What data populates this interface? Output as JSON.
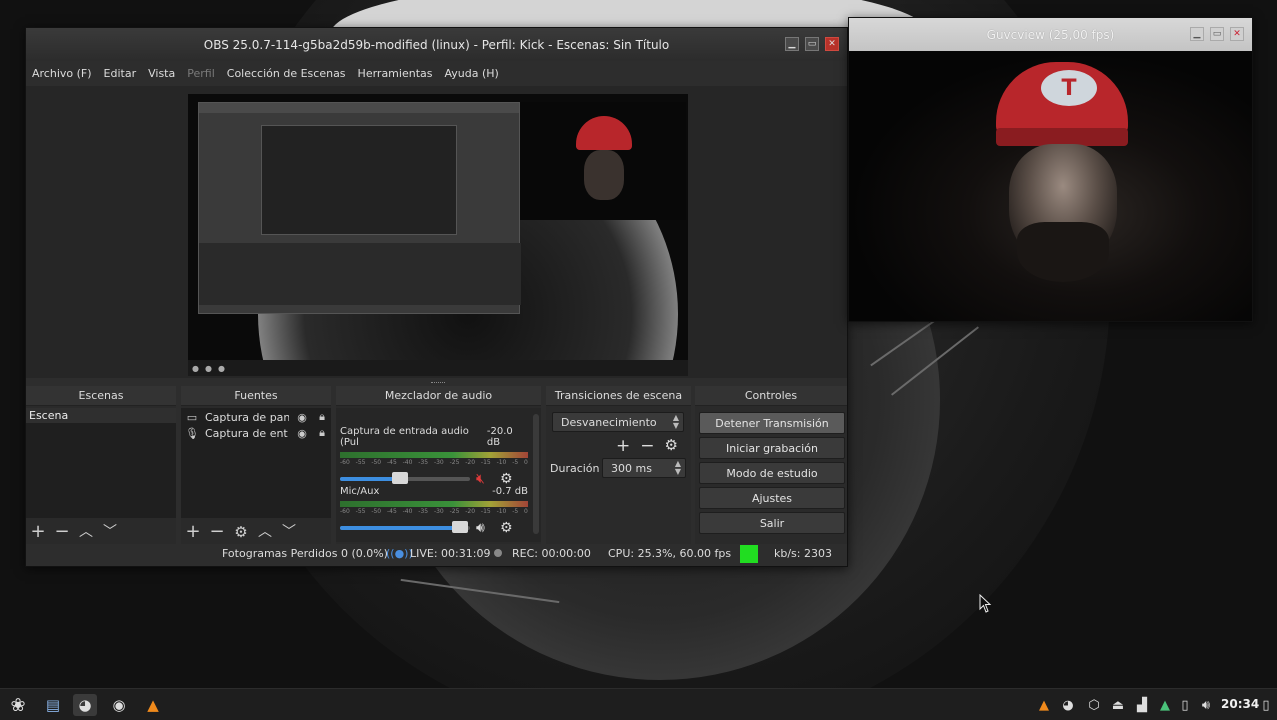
{
  "obs": {
    "title": "OBS 25.0.7-114-g5ba2d59b-modified (linux) - Perfil: Kick - Escenas: Sin Título",
    "menu": [
      "Archivo (F)",
      "Editar",
      "Vista",
      "Perfil",
      "Colección de Escenas",
      "Herramientas",
      "Ayuda (H)"
    ],
    "docks": {
      "scenes": {
        "title": "Escenas",
        "items": [
          "Escena"
        ]
      },
      "sources": {
        "title": "Fuentes",
        "items": [
          {
            "label": "Captura de pan",
            "icon": "monitor-icon"
          },
          {
            "label": "Captura de ent",
            "icon": "microphone-icon"
          }
        ]
      },
      "mixer": {
        "title": "Mezclador de audio",
        "channels": [
          {
            "name": "Captura de entrada audio (Pul",
            "level": "-20.0 dB",
            "fader": 0.46,
            "muted": true
          },
          {
            "name": "Mic/Aux",
            "level": "-0.7 dB",
            "fader": 0.92,
            "muted": false
          }
        ],
        "scale": [
          "-60",
          "-55",
          "-50",
          "-45",
          "-40",
          "-35",
          "-30",
          "-25",
          "-20",
          "-15",
          "-10",
          "-5",
          "0"
        ]
      },
      "transitions": {
        "title": "Transiciones de escena",
        "selected": "Desvanecimiento",
        "duration_label": "Duración",
        "duration_value": "300 ms"
      },
      "controls": {
        "title": "Controles",
        "buttons": [
          "Detener Transmisión",
          "Iniciar grabación",
          "Modo de estudio",
          "Ajustes",
          "Salir"
        ]
      }
    },
    "status": {
      "dropped": "Fotogramas Perdidos 0 (0.0%)",
      "live": "LIVE: 00:31:09",
      "rec": "REC: 00:00:00",
      "cpu": "CPU: 25.3%, 60.00 fps",
      "kbps": "kb/s: 2303",
      "indicator_color": "#21dd21"
    }
  },
  "guvcview": {
    "title": "Guvcview  (25,00 fps)",
    "cap_letter": "T"
  },
  "taskbar": {
    "launchers": [
      "app-menu-icon",
      "file-manager-icon",
      "obs-icon",
      "webcam-icon",
      "vlc-icon"
    ],
    "tray": [
      "vlc-tray-icon",
      "obs-tray-icon",
      "package-icon",
      "eject-icon",
      "signal-icon",
      "notification-icon",
      "clipboard-icon",
      "volume-icon"
    ],
    "clock": "20:34"
  },
  "colors": {
    "live_blue": "#4a8fe0",
    "muted_red": "#e03a3a",
    "close_red": "#b8322a"
  }
}
